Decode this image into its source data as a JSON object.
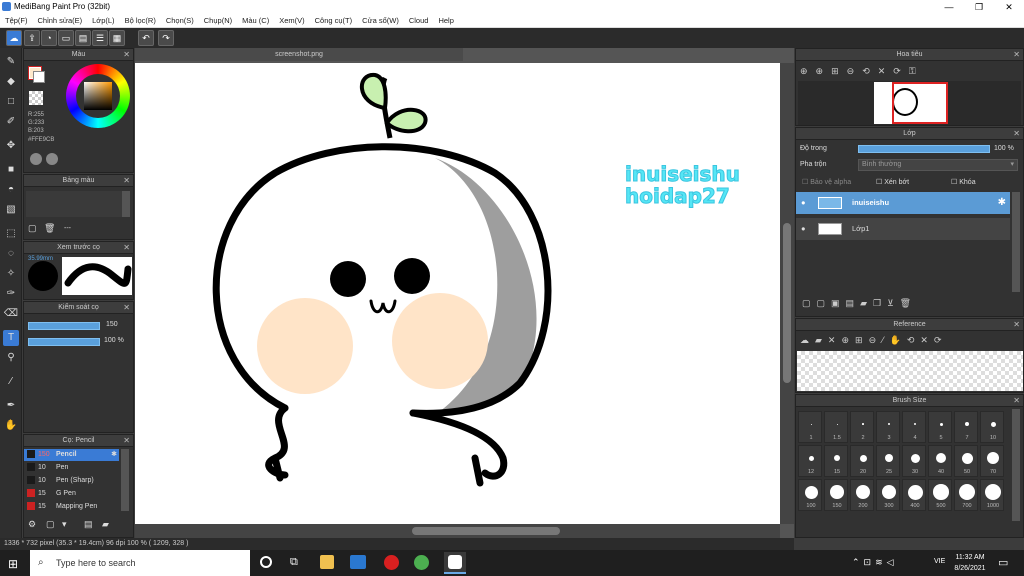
{
  "window": {
    "title": "MediBang Paint Pro (32bit)",
    "minimize": "—",
    "maximize": "❐",
    "close": "✕"
  },
  "menu": [
    "Tệp(F)",
    "Chỉnh sửa(E)",
    "Lớp(L)",
    "Bộ lọc(R)",
    "Chọn(S)",
    "Chụp(N)",
    "Màu (C)",
    "Xem(V)",
    "Công cụ(T)",
    "Cửa sổ(W)",
    "Cloud",
    "Help"
  ],
  "tab": {
    "name": "screenshot.png"
  },
  "panels": {
    "color": {
      "title": "Màu",
      "rgb": [
        "R:255",
        "G:233",
        "B:203"
      ],
      "hex": "#FFE9CB",
      "fg": "#ffe9cb",
      "bg": "#ffffff"
    },
    "palette": {
      "title": "Bảng màu",
      "sep": "---"
    },
    "brush_preview": {
      "title": "Xem trước cọ",
      "size": "35.99mm"
    },
    "brush_control": {
      "title": "Kiểm soát cọ",
      "size": "150",
      "opacity": "100 %"
    },
    "brush_list": {
      "title": "Cọ: Pencil",
      "items": [
        {
          "size": "150",
          "name": "Pencil",
          "color": "#1a1a1a",
          "active": true
        },
        {
          "size": "10",
          "name": "Pen",
          "color": "#1a1a1a",
          "active": false
        },
        {
          "size": "10",
          "name": "Pen (Sharp)",
          "color": "#1a1a1a",
          "active": false
        },
        {
          "size": "15",
          "name": "G Pen",
          "color": "#cc2222",
          "active": false
        },
        {
          "size": "15",
          "name": "Mapping Pen",
          "color": "#cc2222",
          "active": false
        }
      ]
    },
    "navigator": {
      "title": "Hoa tiêu"
    },
    "layer": {
      "title": "Lớp",
      "opacity_label": "Độ trong",
      "opacity_value": "100 %",
      "blend_label": "Pha trộn",
      "blend_value": "Bình thường",
      "protect_alpha": "Bảo vệ alpha",
      "clipping": "Xén bớt",
      "lock": "Khóa",
      "layers": [
        {
          "name": "inuiseishu",
          "active": true
        },
        {
          "name": "Lớp1",
          "active": false
        }
      ]
    },
    "reference": {
      "title": "Reference"
    },
    "brush_size": {
      "title": "Brush Size",
      "row1": [
        "1",
        "1.5",
        "2",
        "3",
        "4",
        "5",
        "7",
        "10"
      ],
      "row2": [
        "12",
        "15",
        "20",
        "25",
        "30",
        "40",
        "50",
        "70"
      ],
      "row3": [
        "100",
        "150",
        "200",
        "300",
        "400",
        "500",
        "700",
        "1000"
      ]
    }
  },
  "canvas": {
    "watermark_line1": "inuiseishu",
    "watermark_line2": "hoidap27"
  },
  "status": {
    "text": "1336 * 732 pixel   (35.3 * 19.4cm)   96 dpi   100 %   ( 1209, 328 )"
  },
  "taskbar": {
    "search_placeholder": "Type here to search",
    "lang": "VIE",
    "time": "11:32 AM",
    "date": "8/26/2021"
  }
}
